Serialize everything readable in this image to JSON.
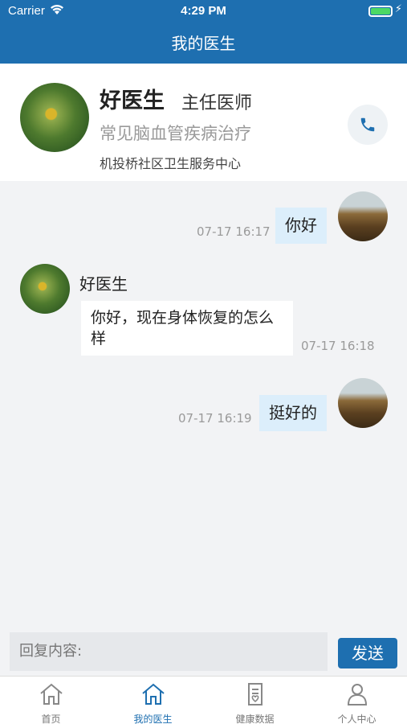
{
  "status_bar": {
    "carrier": "Carrier",
    "time": "4:29 PM"
  },
  "nav": {
    "title": "我的医生"
  },
  "doctor": {
    "name": "好医生",
    "title": "主任医师",
    "specialty": "常见脑血管疾病治疗",
    "clinic": "机投桥社区卫生服务中心"
  },
  "messages": [
    {
      "from": "user",
      "text": "你好",
      "time": "07-17 16:17"
    },
    {
      "from": "doctor",
      "sender": "好医生",
      "text": "你好，现在身体恢复的怎么样",
      "time": "07-17 16:18"
    },
    {
      "from": "user",
      "text": "挺好的",
      "time": "07-17 16:19"
    }
  ],
  "reply": {
    "placeholder": "回复内容:",
    "send_label": "发送"
  },
  "tabs": [
    {
      "label": "首页",
      "icon": "home-icon"
    },
    {
      "label": "我的医生",
      "icon": "home-icon",
      "active": true
    },
    {
      "label": "健康数据",
      "icon": "health-data-icon"
    },
    {
      "label": "个人中心",
      "icon": "person-icon"
    }
  ],
  "colors": {
    "accent": "#1e6fb0",
    "user_bubble": "#dceefb",
    "battery": "#4cd964"
  }
}
